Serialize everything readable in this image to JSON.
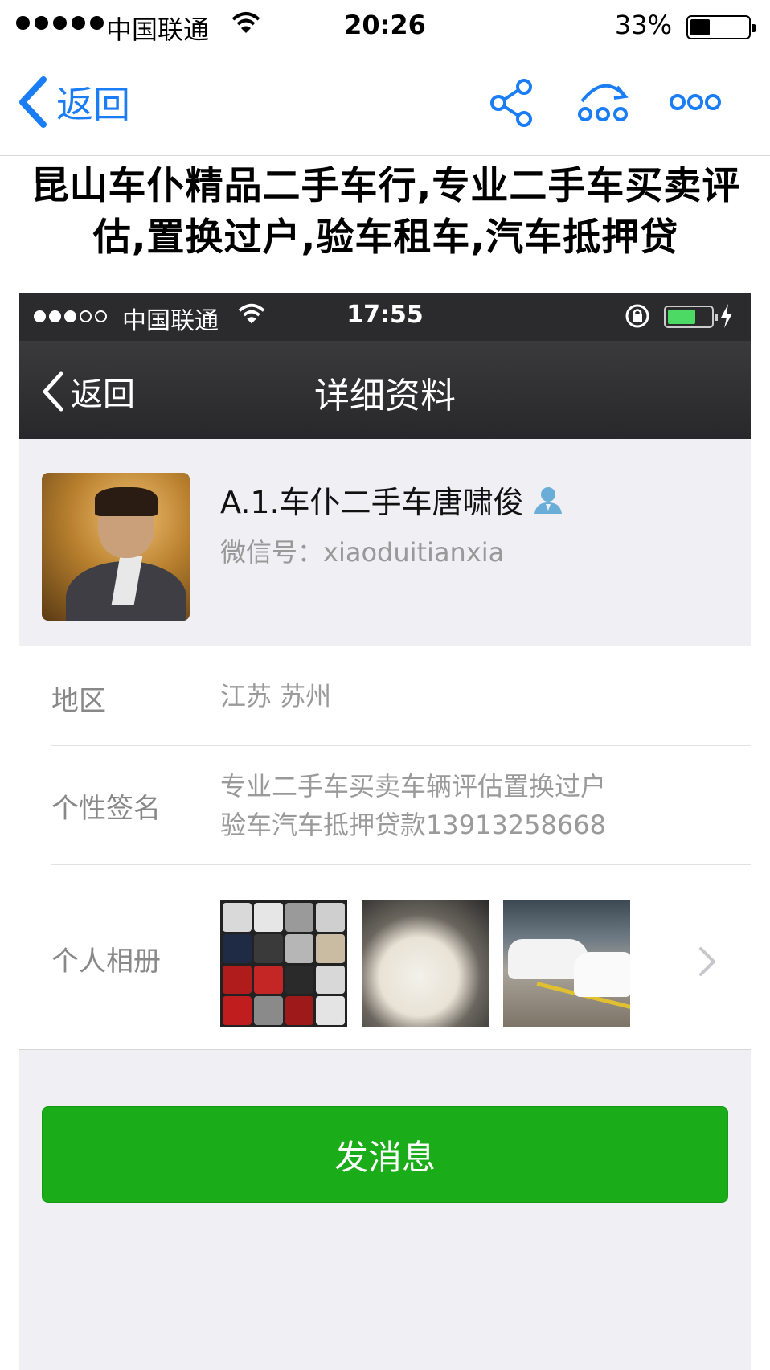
{
  "status_bar": {
    "carrier": "中国联通",
    "time": "20:26",
    "battery_percent": "33%",
    "battery_level": 0.33,
    "signal_bars": 5
  },
  "nav": {
    "back_label": "返回",
    "icons": [
      "share-icon",
      "follow-icon",
      "more-icon"
    ],
    "accent_color": "#1a7df5"
  },
  "article": {
    "title": "昆山车仆精品二手车行,专业二手车买卖评估,置换过户,验车租车,汽车抵押贷"
  },
  "screenshot": {
    "status_bar": {
      "carrier": "中国联通",
      "time": "17:55",
      "signal_filled": 3,
      "signal_total": 5,
      "battery_level": 0.6
    },
    "nav": {
      "back_label": "返回",
      "title": "详细资料"
    },
    "profile": {
      "name": "A.1.车仆二手车唐啸俊",
      "wechat_id": "微信号：xiaoduitianxia"
    },
    "rows": {
      "region": {
        "label": "地区",
        "value": "江苏 苏州"
      },
      "signature": {
        "label": "个性签名",
        "line1": "专业二手车买卖车辆评估置换过户",
        "line2": "验车汽车抵押贷款13913258668"
      },
      "album": {
        "label": "个人相册"
      }
    },
    "send_button": "发消息",
    "button_color": "#1aad19"
  }
}
